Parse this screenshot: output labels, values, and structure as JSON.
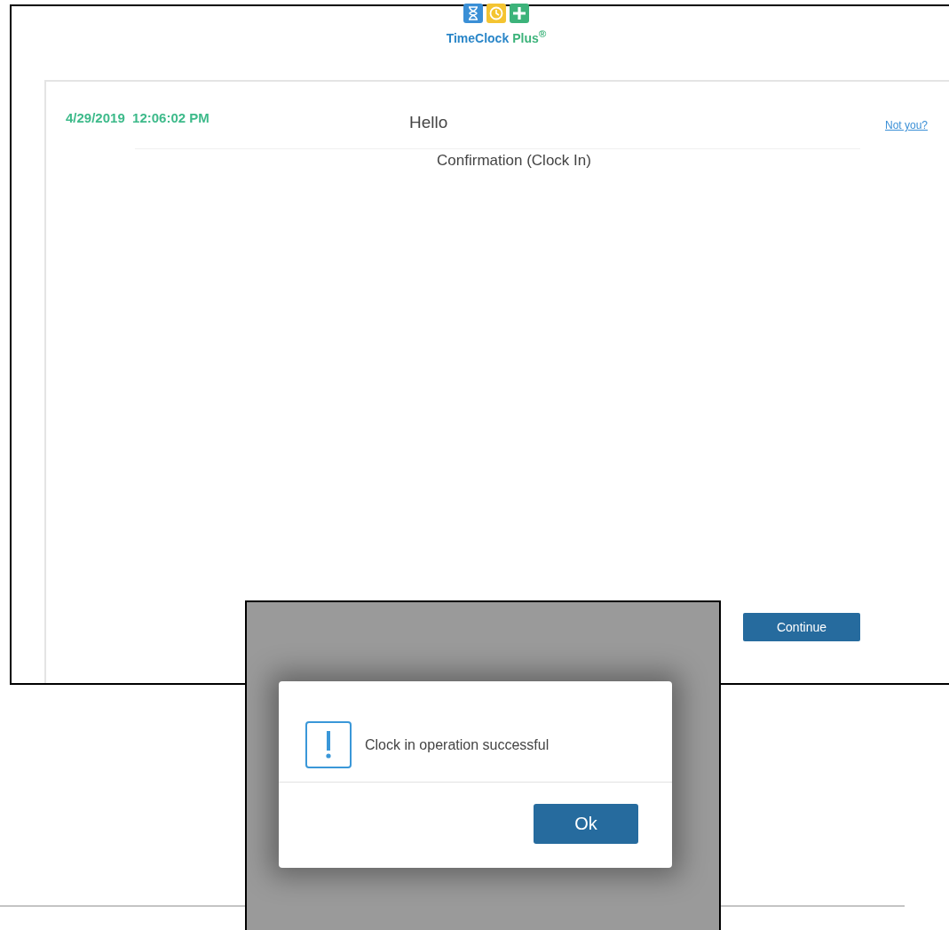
{
  "logo": {
    "brand_name": "TimeClock",
    "brand_suffix": "Plus$^{®}$"
  },
  "card": {
    "datetime": "4/29/2019  12:06:02 PM",
    "greeting": "Hello",
    "not_you_link": "Not you?",
    "subtitle": "Confirmation (Clock In)",
    "continue_button": "Continue"
  },
  "dialog": {
    "message": "Clock in operation successful",
    "ok_button": "Ok"
  }
}
